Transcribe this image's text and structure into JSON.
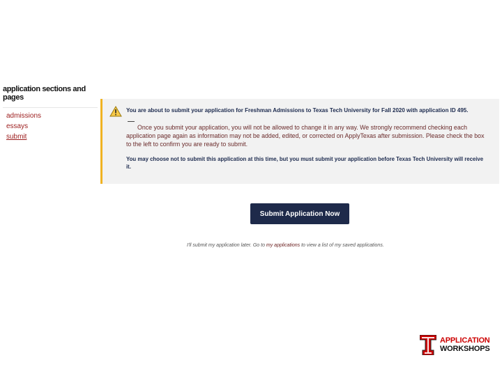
{
  "sidebar": {
    "title": "application sections and pages",
    "items": [
      {
        "label": "admissions"
      },
      {
        "label": "essays"
      },
      {
        "label": "submit"
      }
    ]
  },
  "warning": {
    "icon": "warning-triangle-icon",
    "accent_color": "#f0b323",
    "headline": "You are about to submit your application for Freshman Admissions to Texas Tech University for Fall 2020 with application ID 495.",
    "body": "Once you submit your application, you will not be allowed to change it in any way. We strongly recommend checking each application page again as information may not be added, edited, or corrected on ApplyTexas after submission. Please check the box to the left to confirm you are ready to submit.",
    "note": "You may choose not to submit this application at this time, but you must submit your application before Texas Tech University will receive it."
  },
  "submit_button": {
    "label": "Submit Application Now",
    "color": "#1e2a4a"
  },
  "later": {
    "prefix": "I'll submit my application later. Go to ",
    "link_label": "my applications",
    "suffix": " to view a list of my saved applications."
  },
  "logo": {
    "icon": "double-t-logo-icon",
    "line1": "APPLICATION",
    "line2": "WORKSHOPS",
    "color": "#cc0000"
  }
}
